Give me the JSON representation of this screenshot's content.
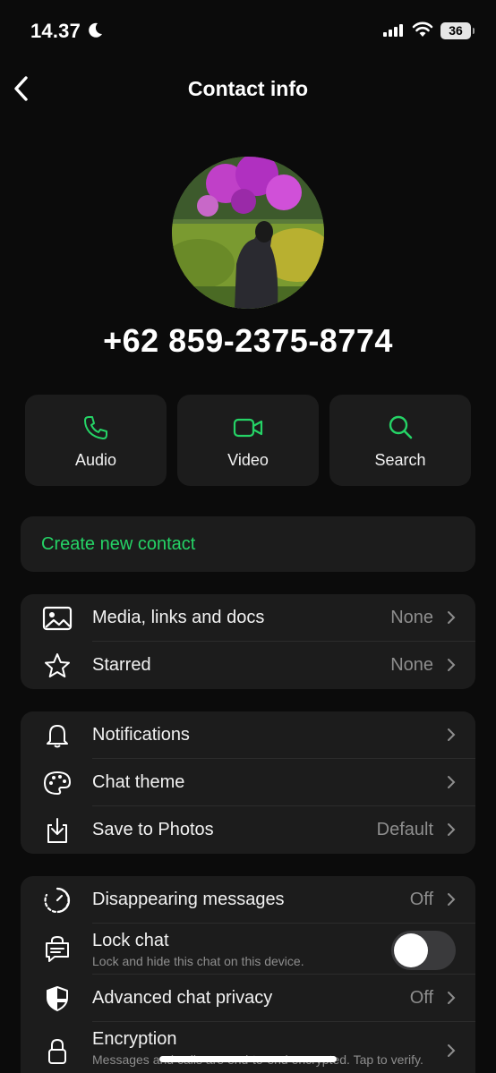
{
  "status": {
    "time": "14.37",
    "battery": "36"
  },
  "header": {
    "title": "Contact info"
  },
  "contact": {
    "phone": "+62 859-2375-8774"
  },
  "actions": [
    {
      "label": "Audio",
      "icon": "phone-icon"
    },
    {
      "label": "Video",
      "icon": "video-icon"
    },
    {
      "label": "Search",
      "icon": "search-icon"
    }
  ],
  "create_contact": {
    "label": "Create new contact"
  },
  "media_section": [
    {
      "label": "Media, links and docs",
      "value": "None",
      "icon": "image-icon"
    },
    {
      "label": "Starred",
      "value": "None",
      "icon": "star-icon"
    }
  ],
  "settings_section": [
    {
      "label": "Notifications",
      "value": "",
      "icon": "bell-icon"
    },
    {
      "label": "Chat theme",
      "value": "",
      "icon": "palette-icon"
    },
    {
      "label": "Save to Photos",
      "value": "Default",
      "icon": "download-icon"
    }
  ],
  "privacy_section": {
    "disappearing": {
      "label": "Disappearing messages",
      "value": "Off"
    },
    "lock_chat": {
      "label": "Lock chat",
      "subtitle": "Lock and hide this chat on this device.",
      "toggle_on": false
    },
    "advanced": {
      "label": "Advanced chat privacy",
      "value": "Off"
    },
    "encryption": {
      "label": "Encryption",
      "subtitle": "Messages and calls are end-to-end encrypted. Tap to verify."
    }
  },
  "colors": {
    "accent": "#25d366",
    "background": "#0b0b0b",
    "card": "#1c1c1c",
    "secondary_text": "#8e8e8e"
  }
}
